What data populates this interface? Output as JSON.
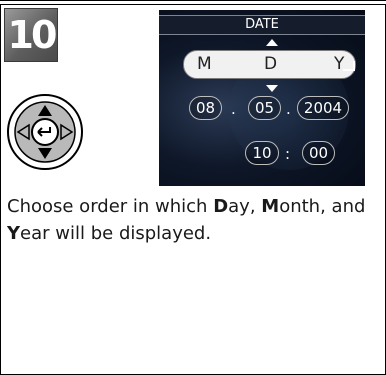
{
  "step": {
    "number": "10"
  },
  "screen": {
    "title": "DATE",
    "order_labels": [
      "M",
      "D",
      "Y"
    ],
    "date": {
      "month": "08",
      "day": "05",
      "year": "2004",
      "separator": "."
    },
    "time": {
      "hour": "10",
      "minute": "00",
      "separator": ":"
    }
  },
  "instruction": {
    "parts": [
      {
        "text": "Choose order in which ",
        "bold": false
      },
      {
        "text": "D",
        "bold": true
      },
      {
        "text": "ay, ",
        "bold": false
      },
      {
        "text": "M",
        "bold": true
      },
      {
        "text": "onth, and ",
        "bold": false
      },
      {
        "text": "Y",
        "bold": true
      },
      {
        "text": "ear will be displayed.",
        "bold": false
      }
    ]
  }
}
